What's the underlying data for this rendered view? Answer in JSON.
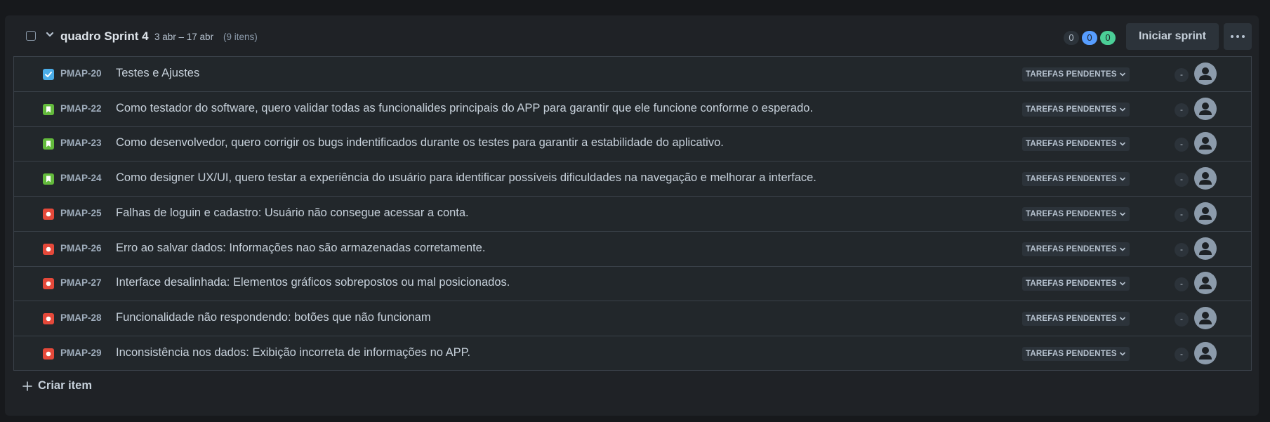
{
  "sprint": {
    "name": "quadro Sprint 4",
    "dates": "3 abr – 17 abr",
    "item_count": "(9 itens)",
    "counts": {
      "todo": "0",
      "in_progress": "0",
      "done": "0"
    },
    "start_button": "Iniciar sprint",
    "more_icon": "more-horizontal-icon"
  },
  "colors": {
    "task": "#4bade8",
    "story": "#63ba3c",
    "bug": "#e5493a",
    "in_progress_badge": "#579dff",
    "done_badge": "#4bce97"
  },
  "items": [
    {
      "type": "task",
      "key": "PMAP-20",
      "summary": "Testes e Ajustes",
      "status": "TAREFAS PENDENTES",
      "estimate": "-"
    },
    {
      "type": "story",
      "key": "PMAP-22",
      "summary": "Como testador do software, quero validar todas as funcionalides principais do APP para garantir que ele funcione conforme o esperado.",
      "status": "TAREFAS PENDENTES",
      "estimate": "-"
    },
    {
      "type": "story",
      "key": "PMAP-23",
      "summary": "Como desenvolvedor, quero corrigir os bugs indentificados durante os testes para garantir a estabilidade do aplicativo.",
      "status": "TAREFAS PENDENTES",
      "estimate": "-"
    },
    {
      "type": "story",
      "key": "PMAP-24",
      "summary": "Como designer UX/UI, quero testar a experiência do usuário para identificar possíveis dificuldades na navegação e melhorar a interface.",
      "status": "TAREFAS PENDENTES",
      "estimate": "-"
    },
    {
      "type": "bug",
      "key": "PMAP-25",
      "summary": "Falhas de loguin e cadastro: Usuário não consegue acessar a conta.",
      "status": "TAREFAS PENDENTES",
      "estimate": "-"
    },
    {
      "type": "bug",
      "key": "PMAP-26",
      "summary": "Erro ao salvar dados: Informações nao são armazenadas corretamente.",
      "status": "TAREFAS PENDENTES",
      "estimate": "-"
    },
    {
      "type": "bug",
      "key": "PMAP-27",
      "summary": "Interface desalinhada: Elementos gráficos sobrepostos ou mal posicionados.",
      "status": "TAREFAS PENDENTES",
      "estimate": "-"
    },
    {
      "type": "bug",
      "key": "PMAP-28",
      "summary": "Funcionalidade não respondendo: botões que não funcionam",
      "status": "TAREFAS PENDENTES",
      "estimate": "-"
    },
    {
      "type": "bug",
      "key": "PMAP-29",
      "summary": "Inconsistência nos dados: Exibição incorreta de informações no APP.",
      "status": "TAREFAS PENDENTES",
      "estimate": "-"
    }
  ],
  "create_item": {
    "label": "Criar item",
    "icon": "plus-icon"
  }
}
